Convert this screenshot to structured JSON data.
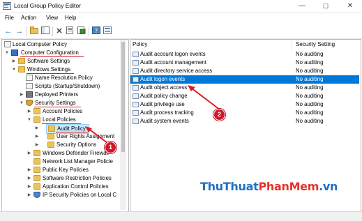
{
  "window": {
    "title": "Local Group Policy Editor",
    "minimize": "—",
    "maximize": "☐",
    "close": "✕"
  },
  "menu": [
    "File",
    "Action",
    "View",
    "Help"
  ],
  "tree": {
    "root": "Local Computer Policy",
    "computer_configuration": "Computer Configuration",
    "software_settings": "Software Settings",
    "windows_settings": "Windows Settings",
    "name_resolution_policy": "Name Resolution Policy",
    "scripts": "Scripts (Startup/Shutdown)",
    "deployed_printers": "Deployed Printers",
    "security_settings": "Security Settings",
    "account_policies": "Account Policies",
    "local_policies": "Local Policies",
    "audit_policy": "Audit Policy",
    "user_rights": "User Rights Assignment",
    "security_options": "Security Options",
    "windows_defender_firewall": "Windows Defender Firewall",
    "network_list_manager": "Network List Manager Policie",
    "public_key": "Public Key Policies",
    "software_restriction": "Software Restriction Policies",
    "application_control": "Application Control Policies",
    "ip_security": "IP Security Policies on Local C"
  },
  "table": {
    "col_policy": "Policy",
    "col_setting": "Security Setting",
    "rows": [
      {
        "name": "Audit account logon events",
        "setting": "No auditing"
      },
      {
        "name": "Audit account management",
        "setting": "No auditing"
      },
      {
        "name": "Audit directory service access",
        "setting": "No auditing"
      },
      {
        "name": "Audit logon events",
        "setting": "No auditing"
      },
      {
        "name": "Audit object access",
        "setting": "No auditing"
      },
      {
        "name": "Audit policy change",
        "setting": "No auditing"
      },
      {
        "name": "Audit privilege use",
        "setting": "No auditing"
      },
      {
        "name": "Audit process tracking",
        "setting": "No auditing"
      },
      {
        "name": "Audit system events",
        "setting": "No auditing"
      }
    ],
    "selected_row": 3
  },
  "annotations": {
    "step1": "1",
    "step2": "2"
  },
  "watermark": {
    "part1": "Thu",
    "part2": "Thuat",
    "part3": "Phan",
    "part4": "Mem",
    "part5": ".vn"
  },
  "colors": {
    "selection": "#0078d7",
    "tree_selection": "#cce8ff",
    "annotation_red": "#e01b24"
  }
}
